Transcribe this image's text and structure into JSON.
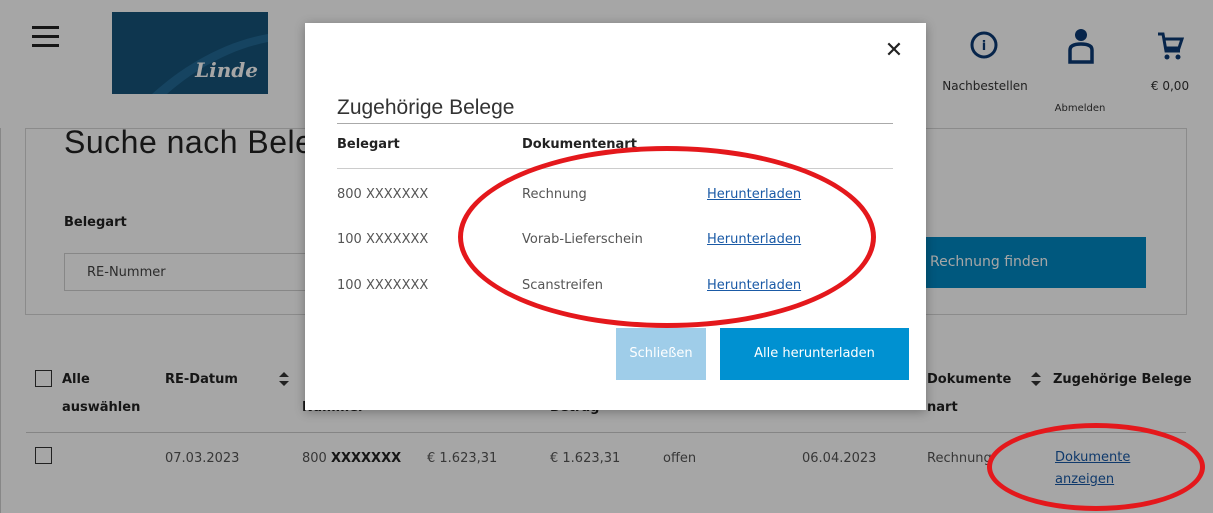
{
  "header": {
    "logo_text": "Linde",
    "reorder_label": "Nachbestellen",
    "logout_label": "Abmelden",
    "cart_total": "€ 0,00"
  },
  "search": {
    "title": "Suche nach Beleg",
    "belegart_label": "Belegart",
    "belegart_value": "RE-Nummer",
    "find_button": "Rechnung finden"
  },
  "table": {
    "select_all_line1": "Alle",
    "select_all_line2": "auswählen",
    "col_re_datum": "RE-Datum",
    "col_nummer": "Nummer",
    "col_betrag": "Betrag",
    "col_dokumentenart_line1": "Dokumente",
    "col_dokumentenart_line2": "nart",
    "col_zugehoerige": "Zugehörige Belege",
    "rows": [
      {
        "re_datum": "07.03.2023",
        "nummer_prefix": "800",
        "nummer_masked": "XXXXXXX",
        "betrag1": "€ 1.623,31",
        "betrag2": "€ 1.623,31",
        "status": "offen",
        "faellig": "06.04.2023",
        "dokumentenart": "Rechnung",
        "link_line1": "Dokumente",
        "link_line2": "anzeigen"
      }
    ]
  },
  "modal": {
    "title": "Zugehörige Belege",
    "col_belegart": "Belegart",
    "col_dokumentenart": "Dokumentenart",
    "rows": [
      {
        "belegart": "800 XXXXXXX",
        "dokumentenart": "Rechnung",
        "action": "Herunterladen"
      },
      {
        "belegart": "100 XXXXXXX",
        "dokumentenart": "Vorab-Lieferschein",
        "action": "Herunterladen"
      },
      {
        "belegart": "100 XXXXXXX",
        "dokumentenart": "Scanstreifen",
        "action": "Herunterladen"
      }
    ],
    "close_button": "Schließen",
    "download_all_button": "Alle herunterladen"
  },
  "colors": {
    "accent": "#0091d1",
    "logo_bg": "#16547a",
    "annotation": "#e4181c"
  },
  "icons": [
    "menu-icon",
    "info-icon",
    "user-icon",
    "cart-icon",
    "sort-icon",
    "close-icon"
  ]
}
